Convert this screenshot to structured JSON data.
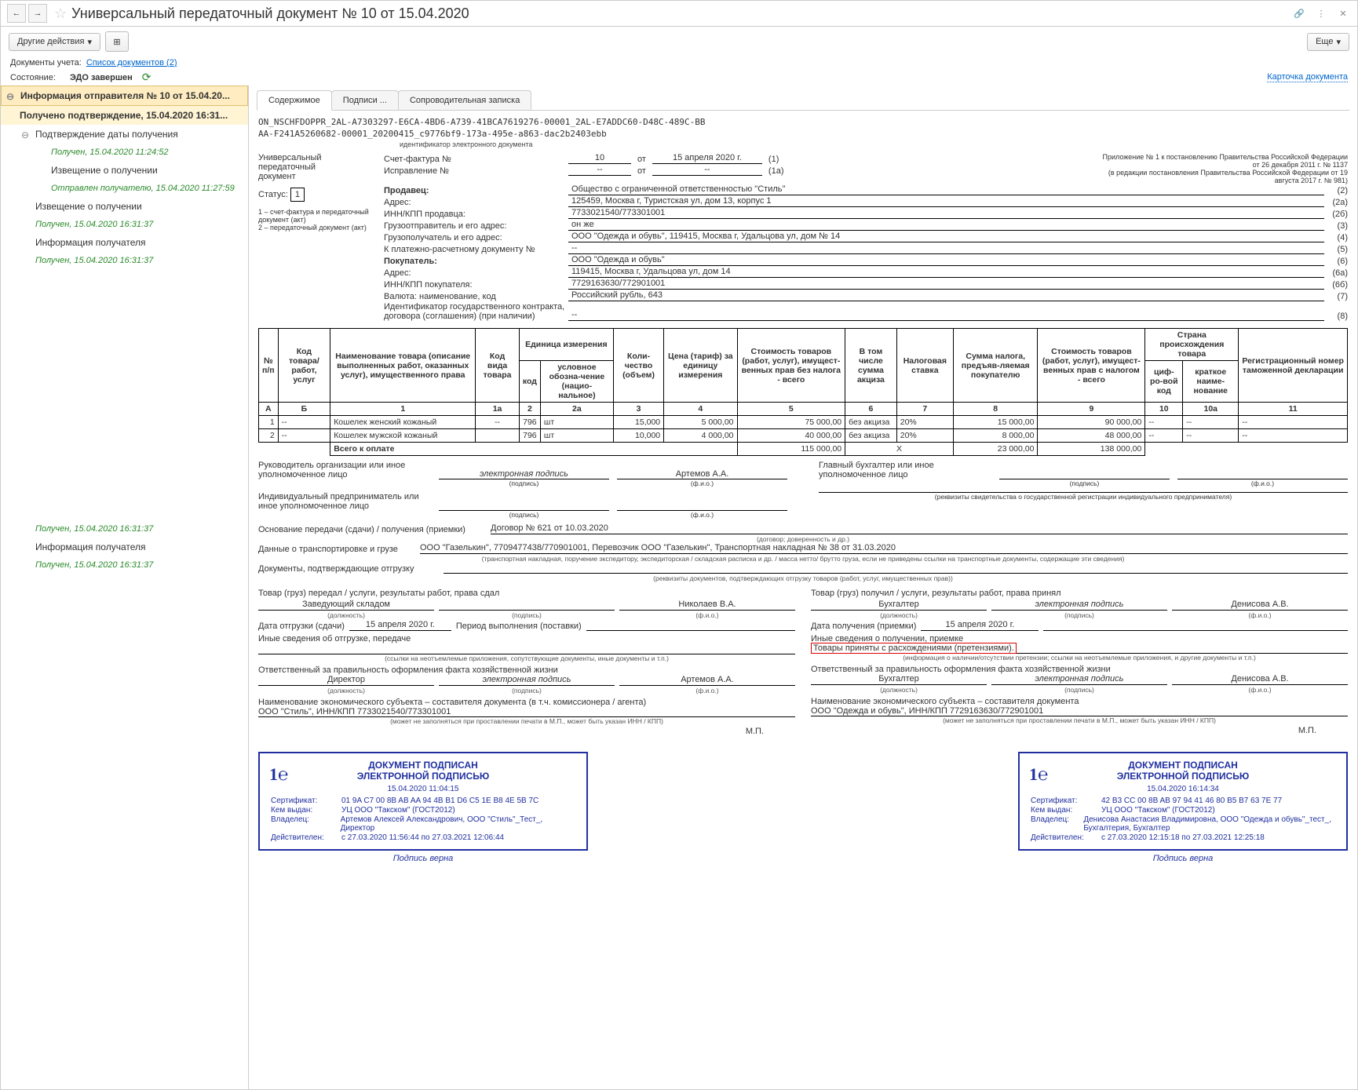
{
  "titlebar": {
    "title": "Универсальный передаточный документ № 10 от 15.04.2020"
  },
  "toolbar": {
    "other_actions": "Другие действия",
    "more": "Еще"
  },
  "meta": {
    "docs_label": "Документы учета:",
    "docs_link": "Список документов (2)",
    "state_label": "Состояние:",
    "state_value": "ЭДО завершен",
    "card_link": "Карточка документа"
  },
  "sidebar": {
    "items": [
      {
        "label": "Информация отправителя № 10 от 15.04.20...",
        "cls": "top"
      },
      {
        "label": "Получено подтверждение, 15.04.2020 16:31...",
        "cls": "sel"
      },
      {
        "label": "Подтверждение даты получения",
        "cls": "child"
      },
      {
        "label": "Получен, 15.04.2020 11:24:52",
        "cls": "gchild side-green"
      },
      {
        "label": "Извещение о получении",
        "cls": "gchild"
      },
      {
        "label": "Отправлен получателю, 15.04.2020 11:27:59",
        "cls": "gchild side-green"
      },
      {
        "label": "Извещение о получении",
        "cls": "child"
      },
      {
        "label": "Получен, 15.04.2020 16:31:37",
        "cls": "child side-green"
      },
      {
        "label": "Информация получателя",
        "cls": "child"
      },
      {
        "label": "Получен, 15.04.2020 16:31:37",
        "cls": "child side-green"
      },
      {
        "label": "",
        "cls": ""
      },
      {
        "label": "Получен, 15.04.2020 16:31:37",
        "cls": "child side-green"
      },
      {
        "label": "Информация получателя",
        "cls": "child"
      },
      {
        "label": "Получен, 15.04.2020 16:31:37",
        "cls": "child side-green"
      }
    ]
  },
  "tabs": [
    {
      "label": "Содержимое",
      "active": true
    },
    {
      "label": "Подписи ..."
    },
    {
      "label": "Сопроводительная записка"
    }
  ],
  "doc": {
    "id_line1": "ON_NSCHFDOPPR_2AL-A7303297-E6CA-4BD6-A739-41BCA7619276-00001_2AL-E7ADDC60-D48C-489C-BB",
    "id_line2": "AA-F241A5260682-00001_20200415_c9776bf9-173a-495e-a863-dac2b2403ebb",
    "id_sub": "идентификатор электронного документа",
    "left": {
      "l1": "Универсальный",
      "l2": "передаточный",
      "l3": "документ",
      "status_label": "Статус:",
      "status": "1",
      "note1": "1 – счет-фактура и передаточный документ (акт)",
      "note2": "2 – передаточный документ (акт)"
    },
    "right_note": "Приложение № 1 к постановлению Правительства Российской Федерации от 26 декабря 2011 г. № 1137\n(в редакции постановления Правительства Российской Федерации от 19 августа 2017 г. № 981)",
    "header": {
      "invoice_label": "Счет-фактура №",
      "invoice_no": "10",
      "ot": "от",
      "invoice_date": "15 апреля 2020 г.",
      "n1": "(1)",
      "correction_label": "Исправление №",
      "correction_no": "--",
      "correction_date": "--",
      "n1a": "(1а)"
    },
    "rows": [
      {
        "lbl": "Продавец:",
        "val": "Общество с ограниченной ответственностью \"Стиль\"",
        "n": "(2)"
      },
      {
        "lbl": "Адрес:",
        "val": "125459, Москва г, Туристская ул, дом 13, корпус 1",
        "n": "(2а)"
      },
      {
        "lbl": "ИНН/КПП продавца:",
        "val": "7733021540/773301001",
        "n": "(2б)"
      },
      {
        "lbl": "Грузоотправитель и его адрес:",
        "val": "он же",
        "n": "(3)"
      },
      {
        "lbl": "Грузополучатель и его адрес:",
        "val": "ООО \"Одежда и обувь\", 119415, Москва г, Удальцова ул, дом № 14",
        "n": "(4)"
      },
      {
        "lbl": "К платежно-расчетному документу №",
        "val": "--",
        "n": "(5)"
      },
      {
        "lbl": "Покупатель:",
        "val": "ООО \"Одежда и обувь\"",
        "n": "(6)"
      },
      {
        "lbl": "Адрес:",
        "val": "119415, Москва г, Удальцова ул, дом 14",
        "n": "(6а)"
      },
      {
        "lbl": "ИНН/КПП покупателя:",
        "val": "7729163630/772901001",
        "n": "(6б)"
      },
      {
        "lbl": "Валюта: наименование, код",
        "val": "Российский рубль, 643",
        "n": "(7)"
      },
      {
        "lbl": "Идентификатор государственного контракта, договора (соглашения) (при наличии)",
        "val": "--",
        "n": "(8)"
      }
    ]
  },
  "table": {
    "headers": {
      "h1": "№ п/п",
      "h2": "Код товара/ работ, услуг",
      "h3": "Наименование товара (описание выполненных работ, оказанных услуг), имущественного права",
      "h4": "Код вида товара",
      "h5": "Единица измерения",
      "h5a": "код",
      "h5b": "условное обозна-чение (нацио-нальное)",
      "h6": "Коли-чество (объем)",
      "h7": "Цена (тариф) за единицу измерения",
      "h8": "Стоимость товаров (работ, услуг), имущест-венных прав без налога - всего",
      "h9": "В том числе сумма акциза",
      "h10": "Налоговая ставка",
      "h11": "Сумма налога, предъяв-ляемая покупателю",
      "h12": "Стоимость товаров (работ, услуг), имущест-венных прав с налогом - всего",
      "h13": "Страна происхождения товара",
      "h13a": "циф-ро-вой код",
      "h13b": "краткое наиме-нование",
      "h14": "Регистрационный номер таможенной декларации"
    },
    "hnums": [
      "А",
      "Б",
      "1",
      "1а",
      "2",
      "2а",
      "3",
      "4",
      "5",
      "6",
      "7",
      "8",
      "9",
      "10",
      "10а",
      "11"
    ],
    "rows": [
      {
        "n": "1",
        "code": "--",
        "name": "Кошелек женский кожаный",
        "kind": "--",
        "ucode": "796",
        "uname": "шт",
        "qty": "15,000",
        "price": "5 000,00",
        "sum": "75 000,00",
        "excise": "без акциза",
        "rate": "20%",
        "tax": "15 000,00",
        "total": "90 000,00",
        "ccode": "--",
        "cname": "--",
        "decl": "--"
      },
      {
        "n": "2",
        "code": "--",
        "name": "Кошелек мужской кожаный",
        "kind": "",
        "ucode": "796",
        "uname": "шт",
        "qty": "10,000",
        "price": "4 000,00",
        "sum": "40 000,00",
        "excise": "без акциза",
        "rate": "20%",
        "tax": "8 000,00",
        "total": "48 000,00",
        "ccode": "--",
        "cname": "--",
        "decl": "--"
      }
    ],
    "total": {
      "label": "Всего к оплате",
      "sum": "115 000,00",
      "x": "Х",
      "tax": "23 000,00",
      "total": "138 000,00"
    }
  },
  "sigs": {
    "head_label": "Руководитель организации или иное уполномоченное лицо",
    "esig": "электронная подпись",
    "head_name": "Артемов А.А.",
    "chief_label": "Главный бухгалтер или иное уполномоченное лицо",
    "ie_label": "Индивидуальный предприниматель или иное уполномоченное лицо",
    "sub_sig": "(подпись)",
    "sub_fio": "(ф.и.о.)",
    "ie_note": "(реквизиты свидетельства о государственной регистрации индивидуального предпринимателя)"
  },
  "transfer": {
    "basis_label": "Основание передачи (сдачи) / получения (приемки)",
    "basis": "Договор № 621 от 10.03.2020",
    "basis_sub": "(договор; доверенность и др.)",
    "transport_label": "Данные о транспортировке и грузе",
    "transport": "ООО \"Газелькин\", 7709477438/770901001, Перевозчик ООО \"Газелькин\", Транспортная накладная № 38 от 31.03.2020",
    "transport_sub": "(транспортная накладная, поручение экспедитору, экспедиторская / складская расписка и др. / масса нетто/ брутто груза, если не приведены ссылки на транспортные документы, содержащие эти сведения)",
    "docs_label": "Документы, подтверждающие отгрузку",
    "docs_sub": "(реквизиты документов, подтверждающих отгрузку товаров (работ, услуг, имущественных прав))"
  },
  "left_col": {
    "handed": "Товар (груз) передал / услуги, результаты работ, права сдал",
    "pos": "Заведующий складом",
    "name": "Николаев В.А.",
    "pos_sub": "(должность)",
    "sig_sub": "(подпись)",
    "fio_sub": "(ф.и.о.)",
    "date_label": "Дата отгрузки (сдачи)",
    "date": "15 апреля 2020 г.",
    "period_label": "Период выполнения (поставки)",
    "info_label": "Иные сведения об отгрузке, передаче",
    "info_sub": "(ссылки на неотъемлемые приложения, сопутствующие документы, иные документы и т.п.)",
    "resp_label": "Ответственный за правильность оформления факта хозяйственной жизни",
    "resp_pos": "Директор",
    "resp_sig": "электронная подпись",
    "resp_name": "Артемов А.А.",
    "subj_label": "Наименование экономического субъекта – составителя документа (в т.ч. комиссионера / агента)",
    "subj": "ООО \"Стиль\", ИНН/КПП 7733021540/773301001",
    "subj_sub": "(может не заполняться при проставлении печати в М.П., может быть указан ИНН / КПП)",
    "mp": "М.П."
  },
  "right_col": {
    "received": "Товар (груз) получил / услуги, результаты работ, права принял",
    "pos": "Бухгалтер",
    "sig": "электронная подпись",
    "name": "Денисова А.В.",
    "date_label": "Дата получения (приемки)",
    "date": "15 апреля 2020 г.",
    "info_label": "Иные сведения о получении, приемке",
    "info_val": "Товары приняты с расхождениями (претензиями).",
    "info_sub": "(информация о наличии/отсутствии претензии; ссылки на неотъемлемые приложения, и другие документы и т.п.)",
    "resp_label": "Ответственный за правильность оформления факта хозяйственной жизни",
    "resp_pos": "Бухгалтер",
    "resp_sig": "электронная подпись",
    "resp_name": "Денисова А.В.",
    "subj_label": "Наименование экономического субъекта – составителя документа",
    "subj": "ООО \"Одежда и обувь\", ИНН/КПП 7729163630/772901001",
    "subj_sub": "(может не заполняться при проставлении печати в М.П., может быть указан ИНН / КПП)",
    "mp": "М.П."
  },
  "stamps": [
    {
      "title1": "ДОКУМЕНТ ПОДПИСАН",
      "title2": "ЭЛЕКТРОННОЙ ПОДПИСЬЮ",
      "date": "15.04.2020 11:04:15",
      "cert_k": "Сертификат:",
      "cert": "01 9A C7 00 8B AB AA 94 4B B1 D6 C5 1E B8 4E 5B 7C",
      "by_k": "Кем выдан:",
      "by": "УЦ ООО \"Такском\" (ГОСТ2012)",
      "owner_k": "Владелец:",
      "owner": "Артемов Алексей Александрович, ООО \"Стиль\"_Тест_, Директор",
      "valid_k": "Действителен:",
      "valid": "с 27.03.2020 11:56:44 по 27.03.2021 12:06:44",
      "foot": "Подпись верна"
    },
    {
      "title1": "ДОКУМЕНТ ПОДПИСАН",
      "title2": "ЭЛЕКТРОННОЙ ПОДПИСЬЮ",
      "date": "15.04.2020 16:14:34",
      "cert_k": "Сертификат:",
      "cert": "42 B3 CC 00 8B AB 97 94 41 46 80 B5 B7 63 7E 77",
      "by_k": "Кем выдан:",
      "by": "УЦ ООО \"Такском\" (ГОСТ2012)",
      "owner_k": "Владелец:",
      "owner": "Денисова Анастасия Владимировна, ООО \"Одежда и обувь\"_тест_, Бухгалтерия, Бухгалтер",
      "valid_k": "Действителен:",
      "valid": "с 27.03.2020 12:15:18 по 27.03.2021 12:25:18",
      "foot": "Подпись верна"
    }
  ]
}
